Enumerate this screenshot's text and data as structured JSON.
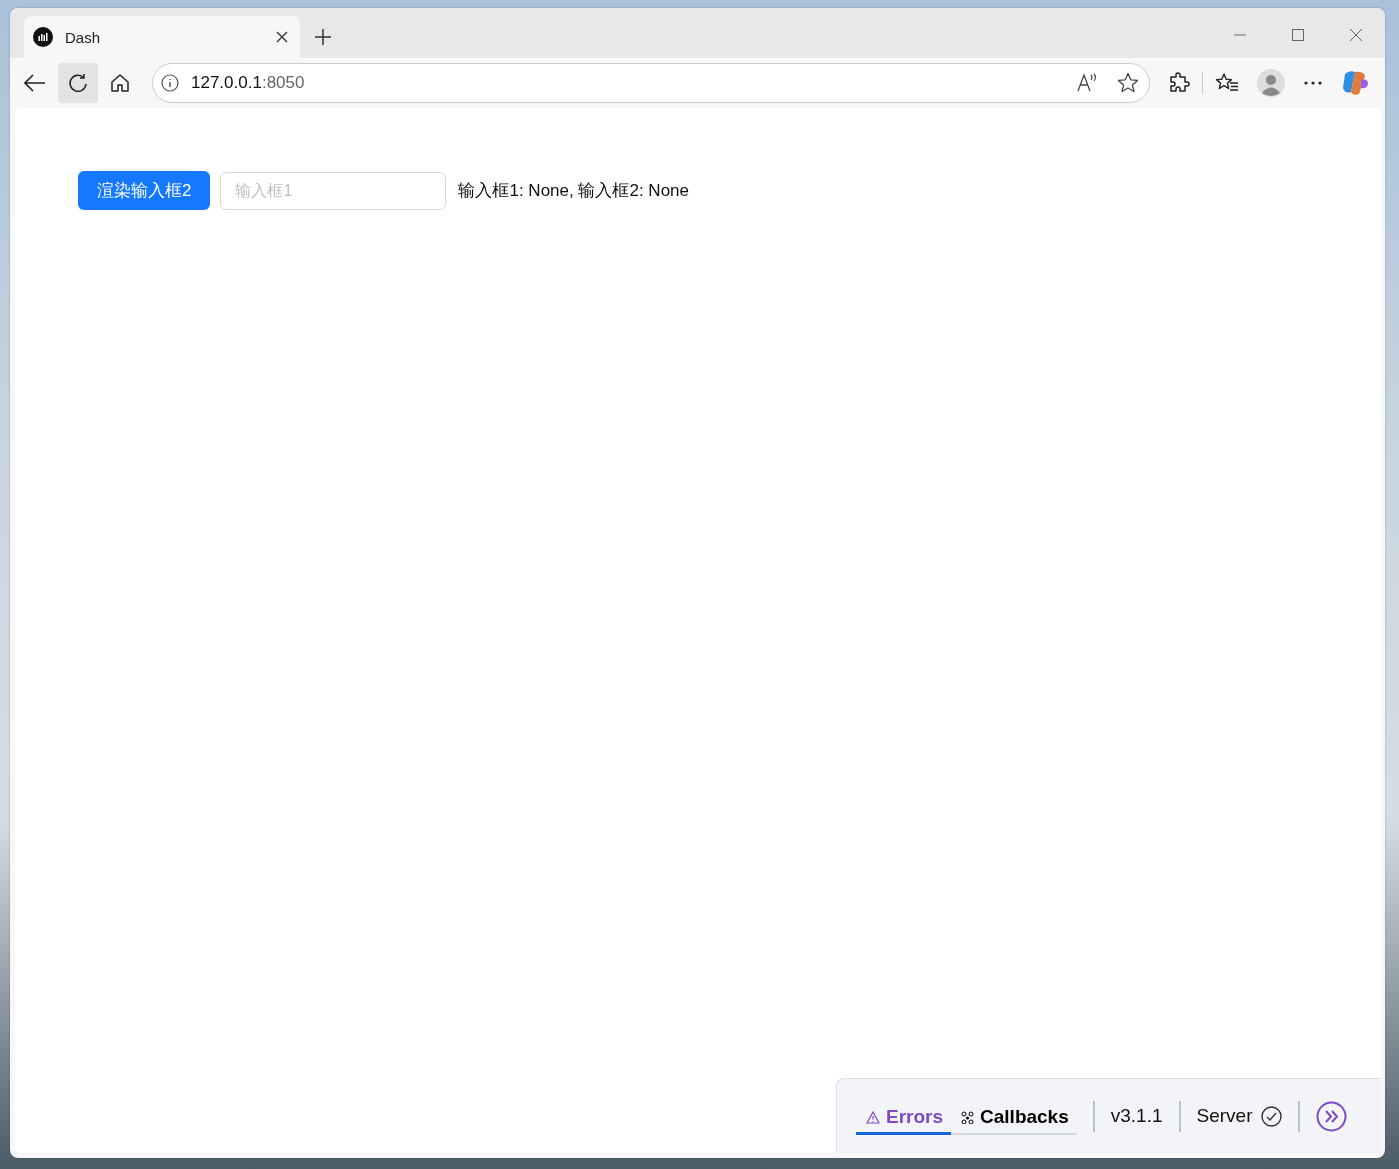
{
  "browser": {
    "tab_title": "Dash",
    "url_host": "127.0.0.1",
    "url_port": ":8050"
  },
  "app": {
    "button": "渲染输入框2",
    "input_placeholder": "输入框1",
    "output": "输入框1: None, 输入框2: None"
  },
  "devtools": {
    "tabs": [
      {
        "label": "Errors",
        "selected": true
      },
      {
        "label": "Callbacks",
        "selected": false
      }
    ],
    "version": "v3.1.1",
    "server": "Server",
    "expanded": false
  }
}
